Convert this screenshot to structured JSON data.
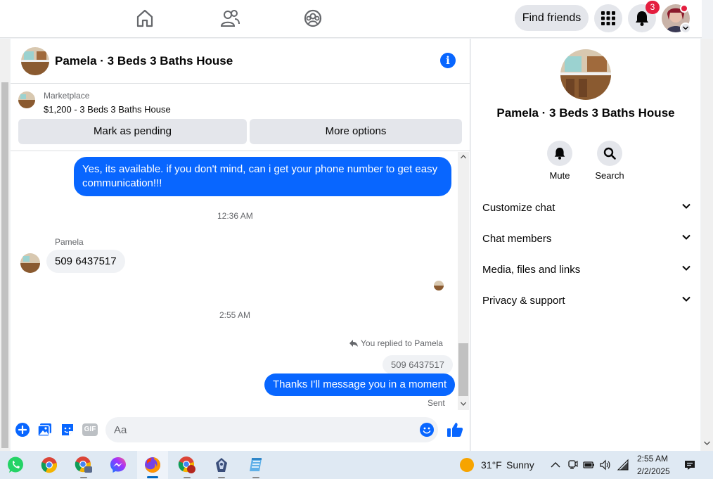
{
  "nav": {
    "find_friends_label": "Find friends",
    "notification_count": "3"
  },
  "chat": {
    "title": "Pamela · 3 Beds 3 Baths House",
    "listing": {
      "source": "Marketplace",
      "price_title": "$1,200 - 3 Beds 3 Baths House",
      "mark_pending_label": "Mark as pending",
      "more_options_label": "More options"
    },
    "messages": [
      {
        "direction": "outgoing",
        "text": "Yes, its available. if you don't mind, can i get your phone number to get easy communication!!!"
      },
      {
        "type": "timestamp",
        "text": "12:36 AM"
      },
      {
        "direction": "incoming",
        "sender": "Pamela",
        "text": "509 6437517"
      },
      {
        "type": "timestamp",
        "text": "2:55 AM"
      },
      {
        "direction": "outgoing",
        "reply_label": "You replied to Pamela",
        "quoted": "509 6437517",
        "text": "Thanks I'll message you in a moment",
        "status": "Sent"
      }
    ],
    "composer": {
      "placeholder": "Aa",
      "gif_label": "GIF"
    }
  },
  "sidebar": {
    "title": "Pamela · 3 Beds 3 Baths House",
    "actions": [
      {
        "label": "Mute",
        "icon": "bell-icon"
      },
      {
        "label": "Search",
        "icon": "search-icon"
      }
    ],
    "sections": [
      {
        "label": "Customize chat"
      },
      {
        "label": "Chat members"
      },
      {
        "label": "Media, files and links"
      },
      {
        "label": "Privacy & support"
      }
    ]
  },
  "taskbar": {
    "apps": [
      "whatsapp-icon",
      "chrome-icon",
      "chrome-profile-icon",
      "messenger-icon",
      "firefox-icon",
      "chrome-alt-icon",
      "app-icon",
      "notepad-icon"
    ],
    "weather_temp": "31°F",
    "weather_condition": "Sunny",
    "time": "2:55 AM",
    "date": "2/2/2025"
  },
  "colors": {
    "accent": "#0866ff",
    "badge": "#e41e3f"
  }
}
